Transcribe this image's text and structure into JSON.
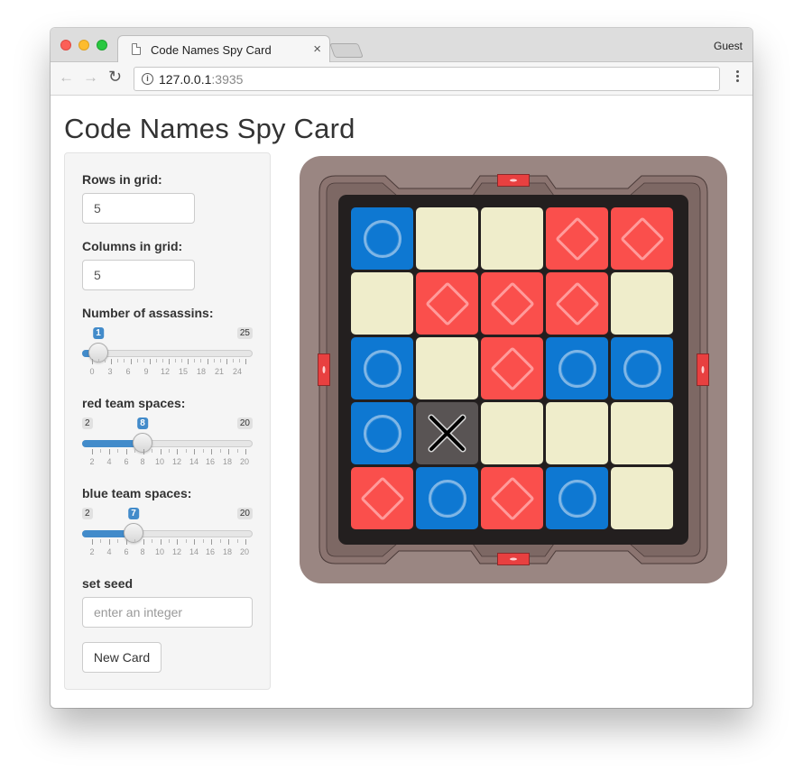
{
  "browser": {
    "tab_title": "Code Names Spy Card",
    "tab_close": "×",
    "profile": "Guest",
    "url_host": "127.0.0.1",
    "url_port": ":3935",
    "back_icon": "arrow-left-icon",
    "forward_icon": "arrow-right-icon",
    "reload_icon": "reload-icon"
  },
  "page": {
    "title": "Code Names Spy Card"
  },
  "sidebar": {
    "rows": {
      "label": "Rows in grid:",
      "value": "5"
    },
    "columns": {
      "label": "Columns in grid:",
      "value": "5"
    },
    "assassins": {
      "label": "Number of assassins:",
      "min": "1",
      "max": "25",
      "value": 1,
      "value_label": "1",
      "ticks": [
        "0",
        "3",
        "6",
        "9",
        "12",
        "15",
        "18",
        "21",
        "24"
      ]
    },
    "red": {
      "label": "red team spaces:",
      "min": "2",
      "max": "20",
      "value": 8,
      "value_label": "8",
      "ticks": [
        "2",
        "4",
        "6",
        "8",
        "10",
        "12",
        "14",
        "16",
        "18",
        "20"
      ]
    },
    "blue": {
      "label": "blue team spaces:",
      "min": "2",
      "max": "20",
      "value": 7,
      "value_label": "7",
      "ticks": [
        "2",
        "4",
        "6",
        "8",
        "10",
        "12",
        "14",
        "16",
        "18",
        "20"
      ]
    },
    "seed": {
      "label": "set seed",
      "placeholder": "enter an integer"
    },
    "new_card_button": "New Card"
  },
  "card": {
    "colors": {
      "blue": "#0e78d2",
      "red": "#fa4f4c",
      "neutral": "#efedcb",
      "assassin": "#595454",
      "frame": "#9a8682"
    },
    "grid": [
      [
        "blue",
        "neutral",
        "neutral",
        "red",
        "red"
      ],
      [
        "neutral",
        "red",
        "red",
        "red",
        "neutral"
      ],
      [
        "blue",
        "neutral",
        "red",
        "blue",
        "blue"
      ],
      [
        "blue",
        "assassin",
        "neutral",
        "neutral",
        "neutral"
      ],
      [
        "red",
        "blue",
        "red",
        "blue",
        "neutral"
      ]
    ]
  }
}
